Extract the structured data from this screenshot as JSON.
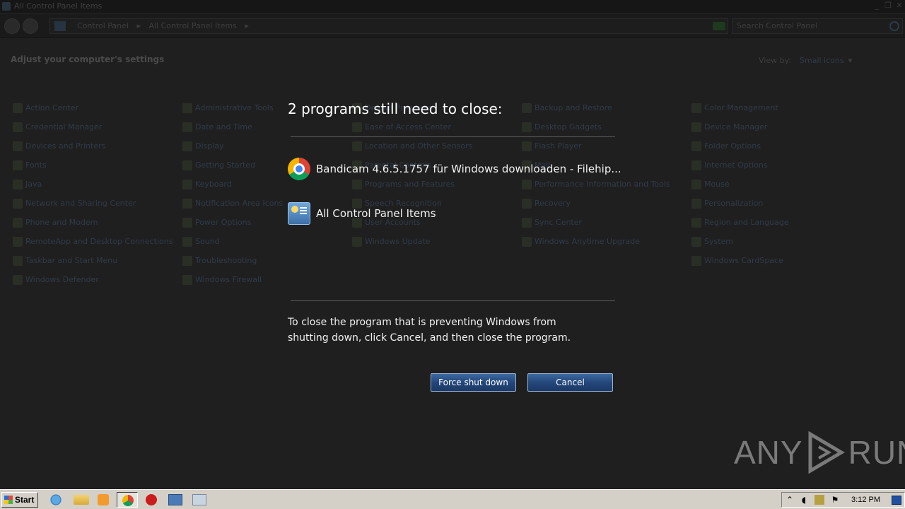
{
  "window": {
    "title": "All Control Panel Items",
    "controls": [
      "_",
      "❐",
      "✕"
    ]
  },
  "address": {
    "crumbs": [
      "Control Panel",
      "▸",
      "All Control Panel Items",
      "▸"
    ],
    "search_placeholder": "Search Control Panel"
  },
  "content": {
    "heading": "Adjust your computer's settings",
    "view_by_label": "View by:",
    "view_by_value": "Small icons",
    "caret": "▾",
    "items": [
      "Action Center",
      "Credential Manager",
      "Devices and Printers",
      "Fonts",
      "Java",
      "Network and Sharing Center",
      "Phone and Modem",
      "RemoteApp and Desktop Connections",
      "Taskbar and Start Menu",
      "Windows Defender",
      "Administrative Tools",
      "Date and Time",
      "Display",
      "Getting Started",
      "Keyboard",
      "Notification Area Icons",
      "Power Options",
      "Sound",
      "Troubleshooting",
      "Windows Firewall",
      "Default Programs",
      "Ease of Access Center",
      "Location and Other Sensors",
      "Parental Controls",
      "Programs and Features",
      "Speech Recognition",
      "User Accounts",
      "Windows Update",
      "Backup and Restore",
      "Desktop Gadgets",
      "Flash Player",
      "Mail",
      "Performance Information and Tools",
      "Recovery",
      "Sync Center",
      "Windows Anytime Upgrade",
      "Color Management",
      "Device Manager",
      "Folder Options",
      "Internet Options",
      "Mouse",
      "Personalization",
      "Region and Language",
      "System",
      "Windows CardSpace"
    ]
  },
  "dialog": {
    "title": "2 programs still need to close:",
    "programs": [
      {
        "label": "Bandicam 4.6.5.1757 für Windows downloaden - Filehip...",
        "icon": "chrome-icon"
      },
      {
        "label": "All Control Panel Items",
        "icon": "control-panel-icon"
      }
    ],
    "instructions": "To close the program that is preventing Windows from shutting down, click Cancel, and then close the program.",
    "force_label": "Force shut down",
    "cancel_label": "Cancel"
  },
  "watermark": {
    "left": "ANY",
    "right": "RUN"
  },
  "taskbar": {
    "start_label": "Start",
    "clock": "3:12 PM"
  }
}
